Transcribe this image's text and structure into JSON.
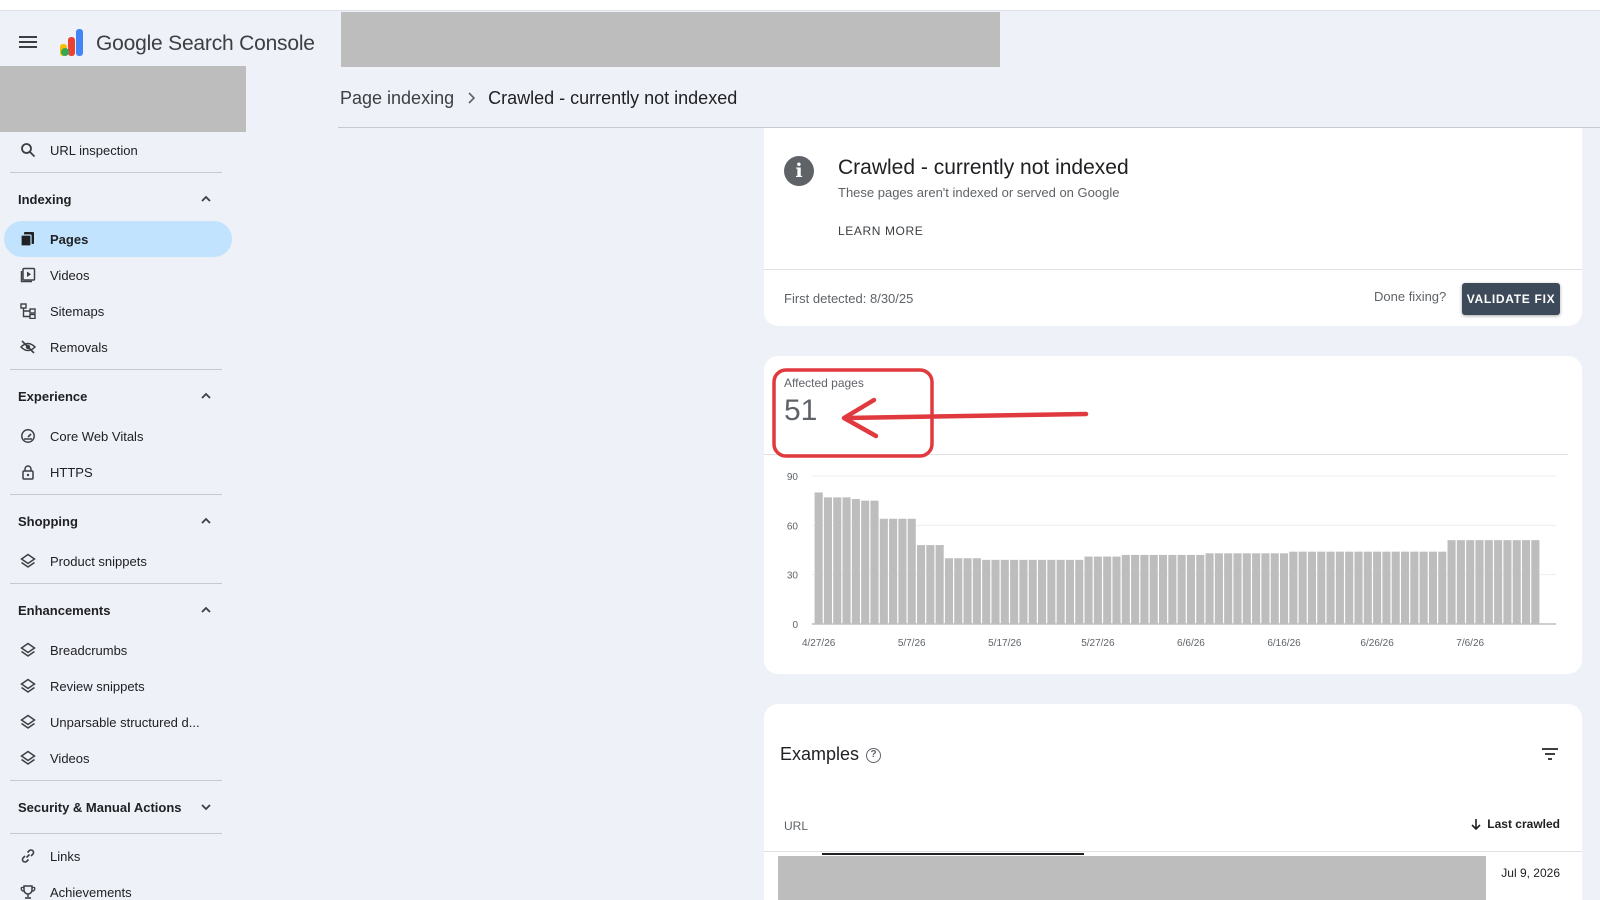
{
  "app": {
    "title": "Google Search Console"
  },
  "breadcrumb": {
    "parent": "Page indexing",
    "current": "Crawled - currently not indexed"
  },
  "sidebar": {
    "url_inspection": "URL inspection",
    "sections": [
      {
        "title": "Indexing",
        "items": [
          "Pages",
          "Videos",
          "Sitemaps",
          "Removals"
        ]
      },
      {
        "title": "Experience",
        "items": [
          "Core Web Vitals",
          "HTTPS"
        ]
      },
      {
        "title": "Shopping",
        "items": [
          "Product snippets"
        ]
      },
      {
        "title": "Enhancements",
        "items": [
          "Breadcrumbs",
          "Review snippets",
          "Unparsable structured d...",
          "Videos"
        ]
      },
      {
        "title": "Security & Manual Actions"
      }
    ],
    "bottom": [
      "Links",
      "Achievements"
    ]
  },
  "issue": {
    "title": "Crawled - currently not indexed",
    "subtitle": "These pages aren't indexed or served on Google",
    "learn_more": "LEARN MORE",
    "first_detected": "First detected: 8/30/25",
    "done_fixing": "Done fixing?",
    "validate_button": "VALIDATE FIX"
  },
  "affected": {
    "label": "Affected pages",
    "value": "51"
  },
  "chart_data": {
    "type": "bar",
    "yticks": [
      0,
      30,
      60,
      90
    ],
    "ylim": [
      0,
      90
    ],
    "xtick_labels": [
      "4/27/26",
      "5/7/26",
      "5/17/26",
      "5/27/26",
      "6/6/26",
      "6/16/26",
      "6/26/26",
      "7/6/26"
    ],
    "values": [
      80,
      77,
      77,
      77,
      76,
      75,
      75,
      64,
      64,
      64,
      64,
      48,
      48,
      48,
      40,
      40,
      40,
      40,
      39,
      39,
      39,
      39,
      39,
      39,
      39,
      39,
      39,
      39,
      39,
      41,
      41,
      41,
      41,
      42,
      42,
      42,
      42,
      42,
      42,
      42,
      42,
      42,
      43,
      43,
      43,
      43,
      43,
      43,
      43,
      43,
      43,
      44,
      44,
      44,
      44,
      44,
      44,
      44,
      44,
      44,
      44,
      44,
      44,
      44,
      44,
      44,
      44,
      44,
      51,
      51,
      51,
      51,
      51,
      51,
      51,
      51,
      51,
      51
    ]
  },
  "examples": {
    "title": "Examples",
    "col_url": "URL",
    "col_last_crawled": "Last crawled",
    "rows": [
      {
        "last_crawled": "Jul 9, 2026"
      }
    ]
  },
  "colors": {
    "bar": "#bdbdbd",
    "annotation": "#e0393e",
    "active_nav": "#c2e3fd",
    "button": "#3c4a5a"
  }
}
